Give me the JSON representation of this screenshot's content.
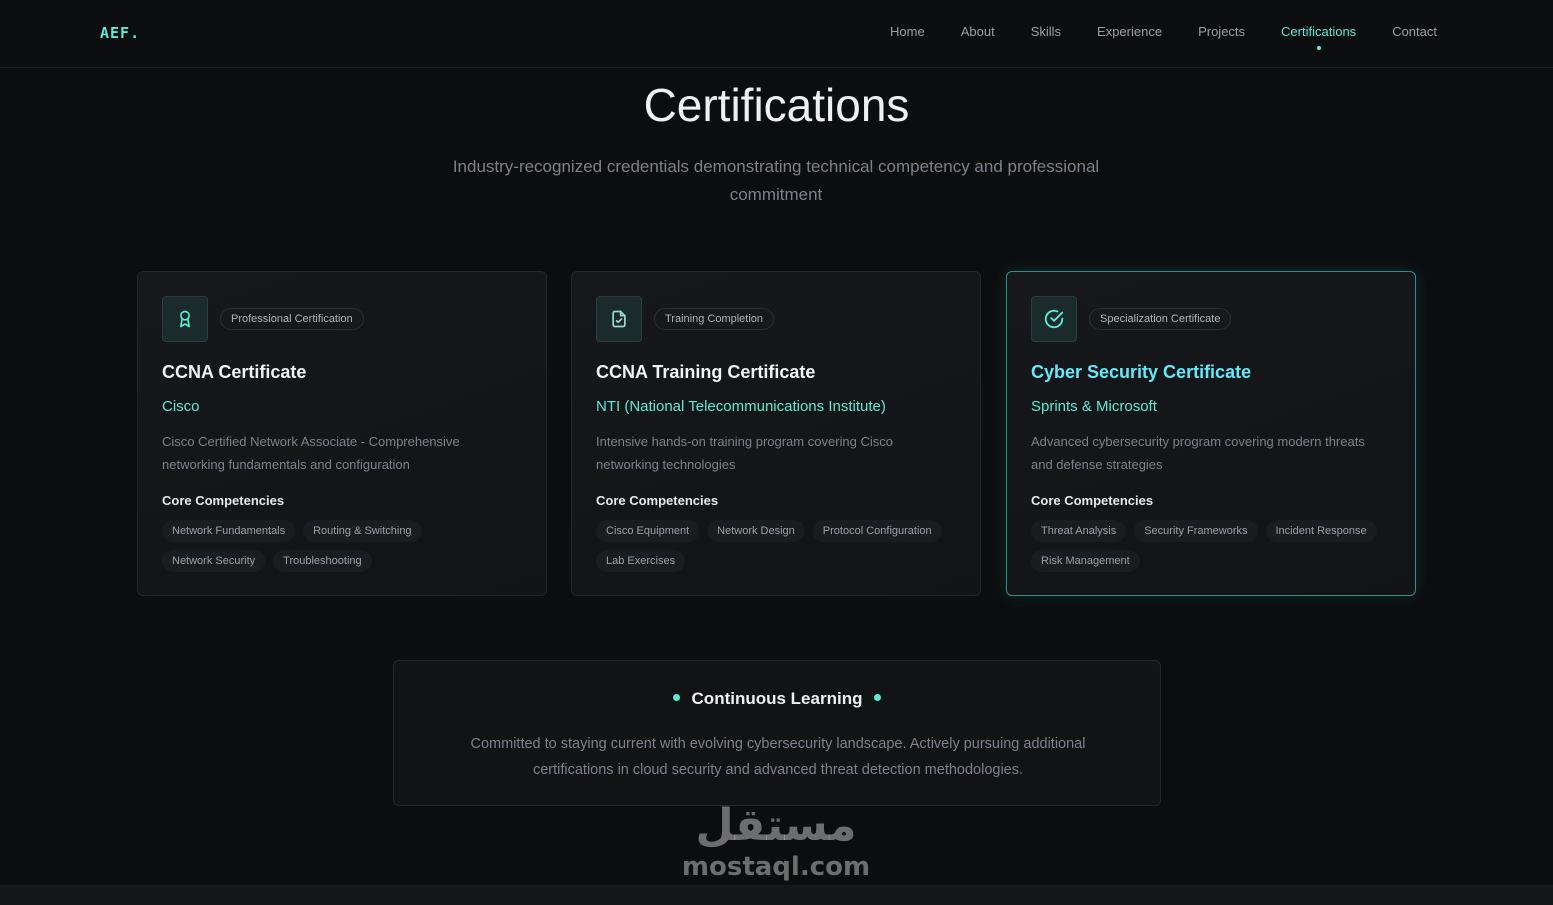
{
  "nav": {
    "logo": "AEF.",
    "links": [
      "Home",
      "About",
      "Skills",
      "Experience",
      "Projects",
      "Certifications",
      "Contact"
    ],
    "active": "Certifications"
  },
  "header": {
    "title": "Certifications",
    "subtitle": "Industry-recognized credentials demonstrating technical competency and professional commitment"
  },
  "cards": [
    {
      "icon": "award-icon",
      "badge": "Professional Certification",
      "title": "CCNA Certificate",
      "issuer": "Cisco",
      "description": "Cisco Certified Network Associate - Comprehensive networking fundamentals and configuration",
      "competencies_label": "Core Competencies",
      "tags": [
        "Network Fundamentals",
        "Routing & Switching",
        "Network Security",
        "Troubleshooting"
      ]
    },
    {
      "icon": "document-check-icon",
      "badge": "Training Completion",
      "title": "CCNA Training Certificate",
      "issuer": "NTI (National Telecommunications Institute)",
      "description": "Intensive hands-on training program covering Cisco networking technologies",
      "competencies_label": "Core Competencies",
      "tags": [
        "Cisco Equipment",
        "Network Design",
        "Protocol Configuration",
        "Lab Exercises"
      ]
    },
    {
      "icon": "circle-check-icon",
      "badge": "Specialization Certificate",
      "title": "Cyber Security Certificate",
      "issuer": "Sprints & Microsoft",
      "description": "Advanced cybersecurity program covering modern threats and defense strategies",
      "competencies_label": "Core Competencies",
      "tags": [
        "Threat Analysis",
        "Security Frameworks",
        "Incident Response",
        "Risk Management"
      ]
    }
  ],
  "learning": {
    "title": "Continuous Learning",
    "text": "Committed to staying current with evolving cybersecurity landscape. Actively pursuing additional certifications in cloud security and advanced threat detection methodologies."
  },
  "watermark": {
    "arabic": "مستقل",
    "latin": "mostaql.com"
  },
  "colors": {
    "accent": "#5eead4",
    "accent_title": "#67e8f9",
    "background": "#0c0d0f"
  }
}
